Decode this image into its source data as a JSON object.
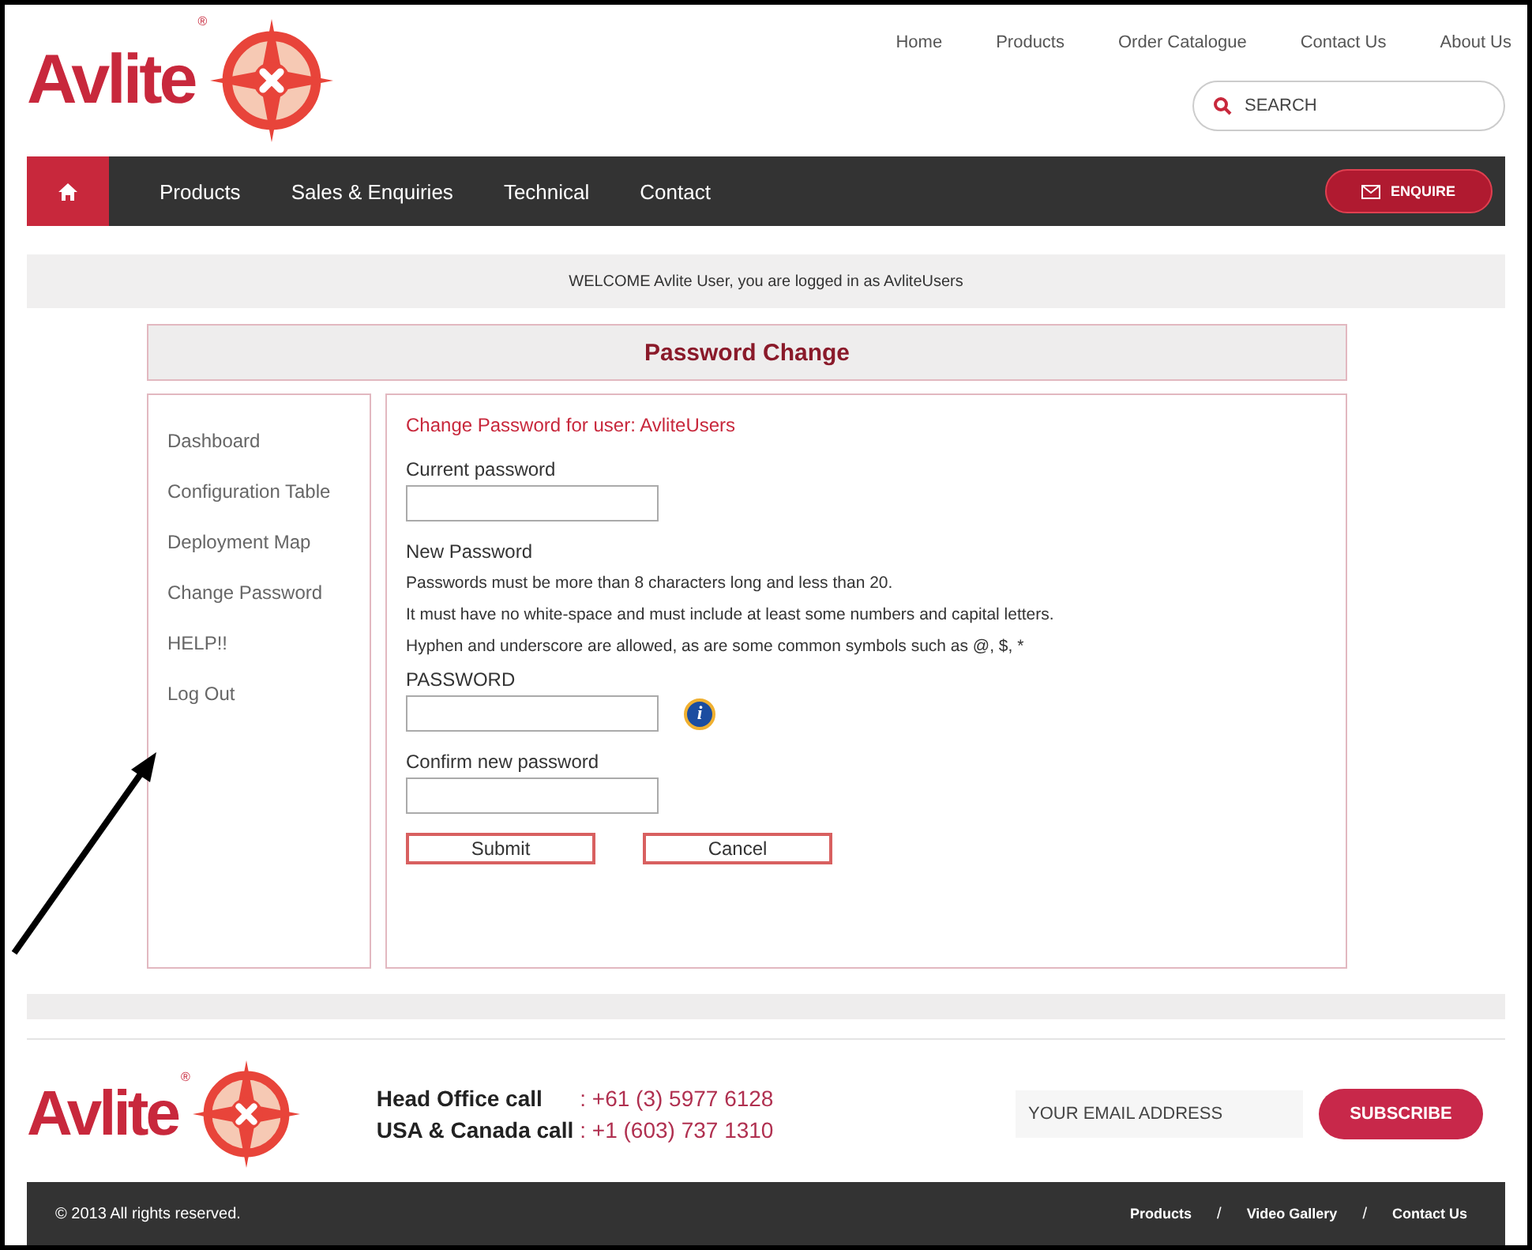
{
  "logo": {
    "text": "Avlite",
    "mark": "®"
  },
  "top_links": [
    "Home",
    "Products",
    "Order Catalogue",
    "Contact Us",
    "About Us"
  ],
  "search": {
    "placeholder": "SEARCH"
  },
  "nav": {
    "items": [
      "Products",
      "Sales & Enquiries",
      "Technical",
      "Contact"
    ],
    "enquire": "ENQUIRE"
  },
  "welcome": "WELCOME Avlite User, you are logged in as AvliteUsers",
  "panel_title": "Password Change",
  "sidebar": {
    "items": [
      {
        "label": "Dashboard"
      },
      {
        "label": "Configuration Table"
      },
      {
        "label": "Deployment Map"
      },
      {
        "label": "Change Password"
      },
      {
        "label": "HELP!!"
      },
      {
        "label": "Log Out"
      }
    ]
  },
  "form": {
    "heading": "Change Password for user: AvliteUsers",
    "current_label": "Current password",
    "new_label": "New Password",
    "rules": [
      "Passwords must be more than 8 characters long and less than 20.",
      "It must have no white-space and must include at least some numbers and capital letters.",
      "Hyphen and underscore are allowed, as are some common symbols such as @, $, *"
    ],
    "password_label": "PASSWORD",
    "info_icon": "i",
    "confirm_label": "Confirm new password",
    "buttons": [
      "Submit",
      "Cancel"
    ]
  },
  "footer": {
    "logo": {
      "text": "Avlite",
      "mark": "®"
    },
    "phones": [
      {
        "label": "Head Office call",
        "sep": ":",
        "number": "+61 (3) 5977 6128"
      },
      {
        "label": "USA & Canada call",
        "sep": ":",
        "number": "+1 (603) 737 1310"
      }
    ],
    "email_placeholder": "YOUR EMAIL ADDRESS",
    "subscribe": "SUBSCRIBE",
    "copyright": "© 2013 All rights reserved.",
    "links": [
      "Products",
      "Video Gallery",
      "Contact Us"
    ],
    "link_sep": "/"
  }
}
